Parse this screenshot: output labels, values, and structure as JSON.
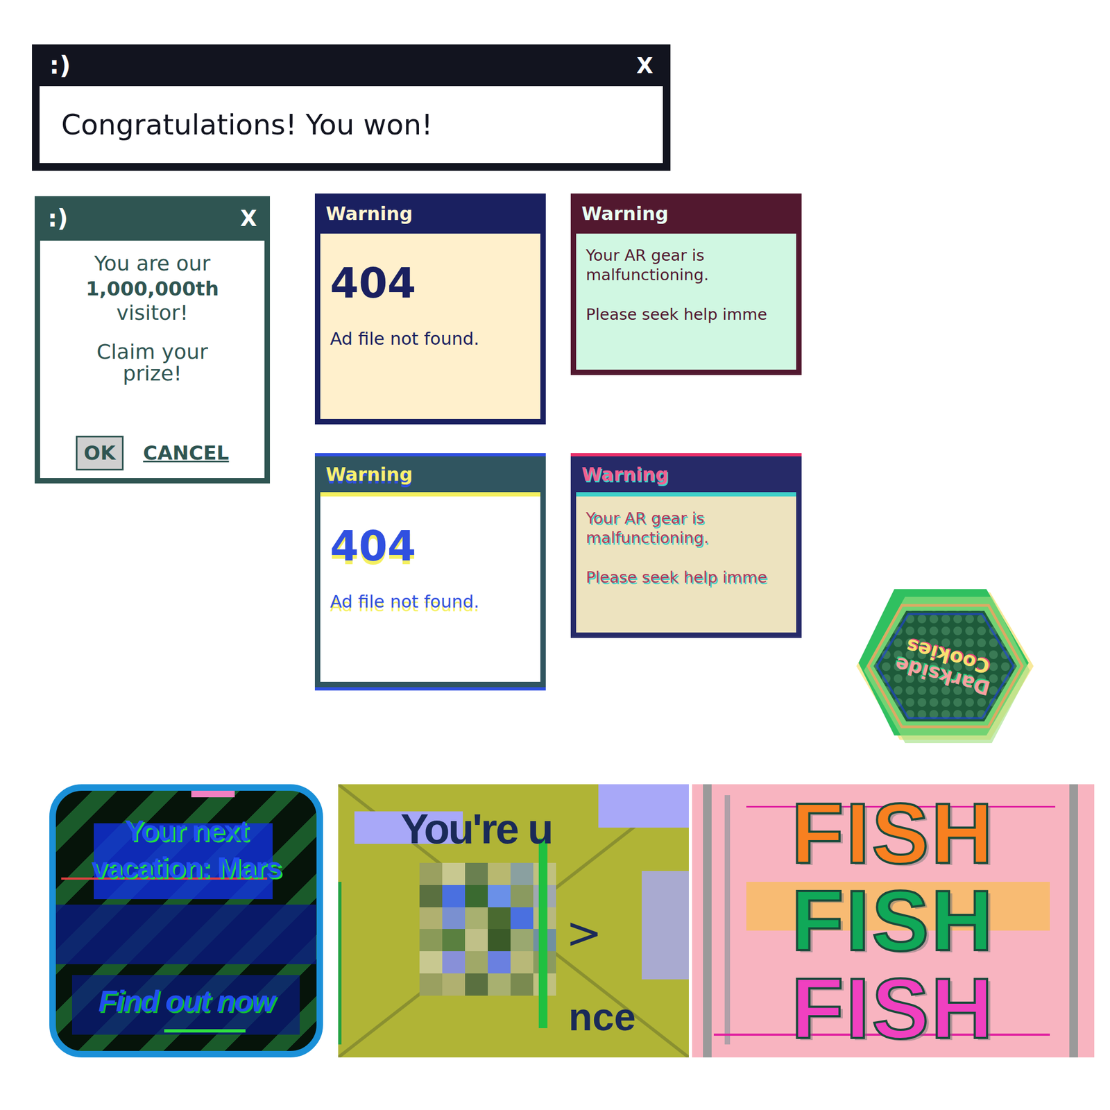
{
  "congrats_window": {
    "title": ":)",
    "close": "X",
    "message": "Congratulations! You won!"
  },
  "visitor_window": {
    "title": ":)",
    "close": "X",
    "intro": "You are our",
    "highlight": "1,000,000th",
    "after": "visitor!",
    "prompt": "Claim your prize!",
    "buttons": [
      {
        "label": "OK",
        "kind": "boxed"
      },
      {
        "label": "CANCEL",
        "kind": "link"
      }
    ]
  },
  "warnings": [
    {
      "title": "Warning",
      "code": "404",
      "lines": [
        "Ad file not found."
      ],
      "kind": "plain",
      "color": "#1a2060"
    },
    {
      "title": "Warning",
      "lines": [
        "Your AR gear is malfunctioning.",
        "Please seek help imme"
      ],
      "kind": "plain",
      "color": "#52182f"
    },
    {
      "title": "Warning",
      "code": "404",
      "lines": [
        "Ad file not found."
      ],
      "kind": "glitch",
      "color": "#305560"
    },
    {
      "title": "Warning",
      "lines": [
        "Your AR gear is malfunctioning.",
        "Please seek help imme"
      ],
      "kind": "glitch",
      "color": "#262a68"
    }
  ],
  "badge": {
    "lines": [
      "Darkside",
      "Cookies"
    ]
  },
  "ads": [
    {
      "kind": "vacation",
      "lines": [
        "Your next",
        "vacation: Mars"
      ],
      "cta": "Find out now"
    },
    {
      "kind": "surveillance",
      "lines": [
        "You're u",
        "nce"
      ],
      "arrow": ">"
    },
    {
      "kind": "fish",
      "words": [
        {
          "text": "FISH",
          "color": "#f88020"
        },
        {
          "text": "FISH",
          "color": "#10a858"
        },
        {
          "text": "FISH",
          "color": "#f040c0"
        }
      ]
    }
  ]
}
